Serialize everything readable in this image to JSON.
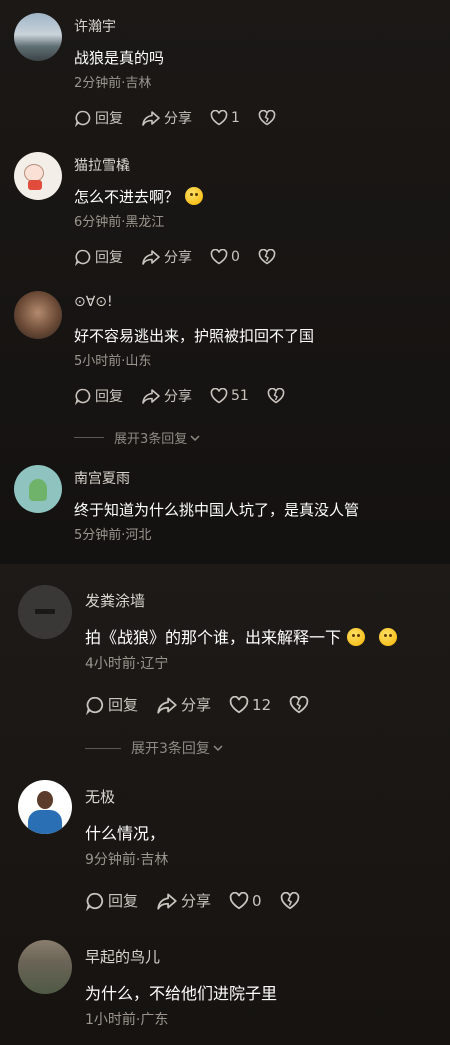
{
  "panel_a": {
    "comments": [
      {
        "user": "许瀚宇",
        "text": "战狼是真的吗",
        "meta": "2分钟前·吉林",
        "reply": "回复",
        "share": "分享",
        "likes": "1"
      },
      {
        "user": "猫拉雪橇",
        "text": "怎么不进去啊？",
        "meta": "6分钟前·黑龙江",
        "reply": "回复",
        "share": "分享",
        "likes": "0"
      },
      {
        "user": "⊙∀⊙!",
        "text": "好不容易逃出来，护照被扣回不了国",
        "meta": "5小时前·山东",
        "reply": "回复",
        "share": "分享",
        "likes": "51"
      },
      {
        "user": "南宫夏雨",
        "text": "终于知道为什么挑中国人坑了，是真没人管",
        "meta": "5分钟前·河北"
      }
    ],
    "expand_label": "展开3条回复"
  },
  "panel_b": {
    "comments": [
      {
        "user": "发粪涂墙",
        "text": "拍《战狼》的那个谁，出来解释一下",
        "meta": "4小时前·辽宁",
        "reply": "回复",
        "share": "分享",
        "likes": "12"
      },
      {
        "user": "无极",
        "text": "什么情况，",
        "meta": "9分钟前·吉林",
        "reply": "回复",
        "share": "分享",
        "likes": "0"
      },
      {
        "user": "早起的鸟儿",
        "text": "为什么，不给他们进院子里",
        "meta": "1小时前·广东"
      }
    ],
    "expand_label": "展开3条回复"
  },
  "colors": {
    "background": "#171412",
    "text": "#ffffff",
    "meta": "#9b958e",
    "action": "#c9c4be"
  }
}
